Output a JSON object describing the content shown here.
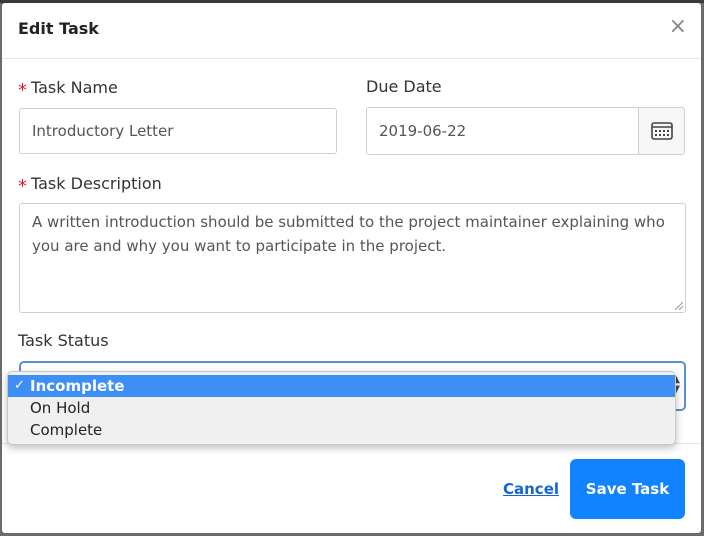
{
  "modal": {
    "title": "Edit Task",
    "close_symbol": "×"
  },
  "form": {
    "required_marker": "*",
    "task_name": {
      "label": "Task Name",
      "value": "Introductory Letter"
    },
    "due_date": {
      "label": "Due Date",
      "value": "2019-06-22",
      "icon": "calendar-icon"
    },
    "task_description": {
      "label": "Task Description",
      "value": "A written introduction should be submitted to the project maintainer explaining who you are and why you want to participate in the project."
    },
    "task_status": {
      "label": "Task Status",
      "selected": "Incomplete",
      "options": [
        "Incomplete",
        "On Hold",
        "Complete"
      ],
      "check_symbol": "✓"
    }
  },
  "footer": {
    "cancel_label": "Cancel",
    "save_label": "Save Task"
  },
  "colors": {
    "primary": "#1183ff",
    "link": "#1565d8",
    "required": "#e02020",
    "selected_option": "#3d8ff5"
  }
}
